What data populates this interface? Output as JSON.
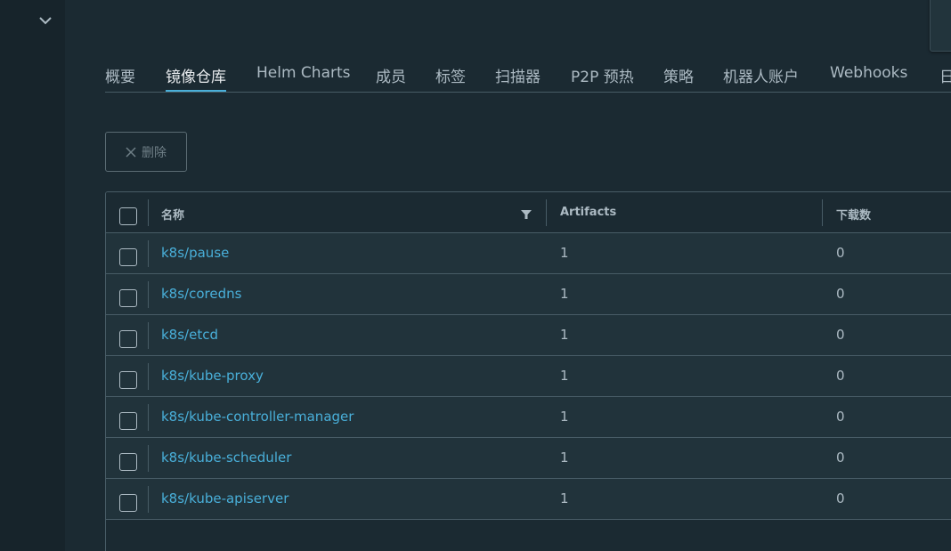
{
  "sidebar": {
    "collapse_icon": "chevron-down-icon"
  },
  "tabs": [
    {
      "label": "概要",
      "active": false
    },
    {
      "label": "镜像仓库",
      "active": true
    },
    {
      "label": "Helm Charts",
      "active": false
    },
    {
      "label": "成员",
      "active": false
    },
    {
      "label": "标签",
      "active": false
    },
    {
      "label": "扫描器",
      "active": false
    },
    {
      "label": "P2P 预热",
      "active": false
    },
    {
      "label": "策略",
      "active": false
    },
    {
      "label": "机器人账户",
      "active": false
    },
    {
      "label": "Webhooks",
      "active": false
    },
    {
      "label": "日",
      "active": false
    }
  ],
  "toolbar": {
    "delete_label": "删除",
    "delete_icon": "close-icon"
  },
  "table": {
    "columns": [
      "名称",
      "Artifacts",
      "下载数"
    ],
    "filter_icon": "filter-icon",
    "rows": [
      {
        "name": "k8s/pause",
        "artifacts": "1",
        "downloads": "0"
      },
      {
        "name": "k8s/coredns",
        "artifacts": "1",
        "downloads": "0"
      },
      {
        "name": "k8s/etcd",
        "artifacts": "1",
        "downloads": "0"
      },
      {
        "name": "k8s/kube-proxy",
        "artifacts": "1",
        "downloads": "0"
      },
      {
        "name": "k8s/kube-controller-manager",
        "artifacts": "1",
        "downloads": "0"
      },
      {
        "name": "k8s/kube-scheduler",
        "artifacts": "1",
        "downloads": "0"
      },
      {
        "name": "k8s/kube-apiserver",
        "artifacts": "1",
        "downloads": "0"
      }
    ]
  },
  "colors": {
    "accent": "#49afd9",
    "background": "#1b2a32",
    "row_background": "#21333b",
    "sidebar": "#17242b",
    "border": "#485c66"
  }
}
